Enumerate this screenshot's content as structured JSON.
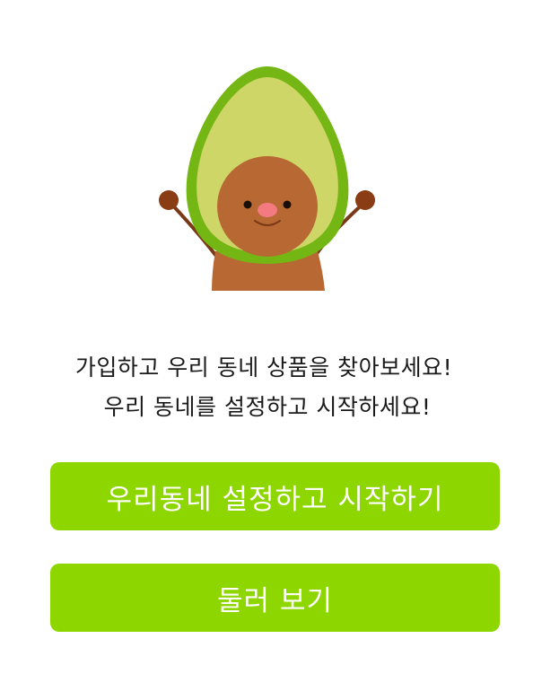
{
  "mascot": {
    "icon": "avocado-mascot-icon",
    "colors": {
      "skin": "#74b613",
      "flesh": "#cdd667",
      "pit": "#b86832",
      "nose": "#f47a82",
      "hands": "#8a3d14"
    }
  },
  "message": {
    "line1": "가입하고 우리 동네 상품을 찾아보세요!",
    "line2": "우리 동네를 설정하고 시작하세요!"
  },
  "buttons": {
    "start_label": "우리동네 설정하고 시작하기",
    "browse_label": "둘러 보기"
  },
  "colors": {
    "accent": "#8ed600",
    "button_text": "#ffffff",
    "body_text": "#1a1a1a"
  }
}
